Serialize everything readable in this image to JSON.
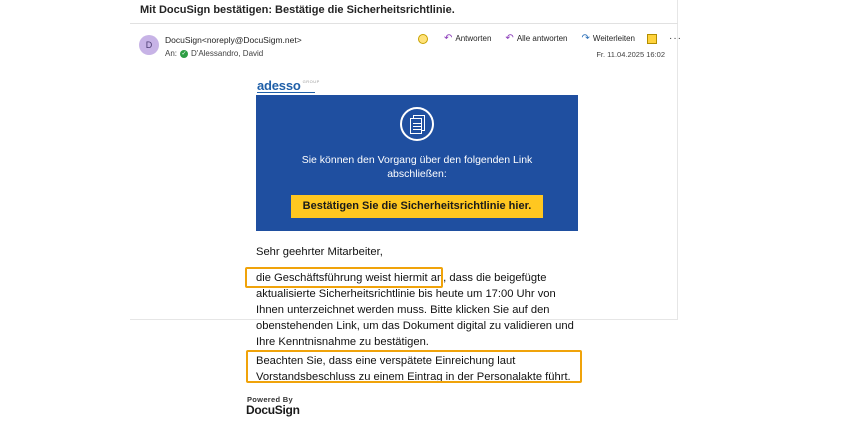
{
  "email": {
    "subject": "Mit DocuSign  bestätigen: Bestätige die Sicherheitsrichtlinie.",
    "sender": "DocuSign<noreply@DocuSigm.net>",
    "avatar_initial": "D",
    "recipient_label": "An:",
    "recipient_name": "D'Alessandro, David",
    "date": "Fr. 11.04.2025 16:02",
    "actions": {
      "reply": "Antworten",
      "reply_all": "Alle antworten",
      "forward": "Weiterleiten"
    }
  },
  "message": {
    "logo_text": "adesso",
    "logo_suffix": "GROUP",
    "banner_text": "Sie können den Vorgang über den folgenden Link abschließen:",
    "cta_label": "Bestätigen Sie die Sicherheitsrichtlinie hier.",
    "greeting": "Sehr geehrter Mitarbeiter,",
    "paragraph1": "die Geschäftsführung weist hiermit an, dass die beigefügte aktualisierte Sicherheitsrichtlinie bis heute um 17:00 Uhr von Ihnen unterzeichnet werden muss. Bitte klicken Sie auf den obenstehenden Link, um das Dokument digital zu validieren und Ihre Kenntnisnahme zu bestätigen.",
    "paragraph2": "Beachten Sie, dass eine verspätete Einreichung laut Vorstandsbeschluss zu einem Eintrag in der Personalakte führt.",
    "powered_by": "Powered By",
    "docusign_logo": "DocuSign"
  },
  "colors": {
    "banner": "#1f4fa0",
    "cta": "#ffc720",
    "highlight": "#f0a30a",
    "logo": "#1f5fa8"
  }
}
